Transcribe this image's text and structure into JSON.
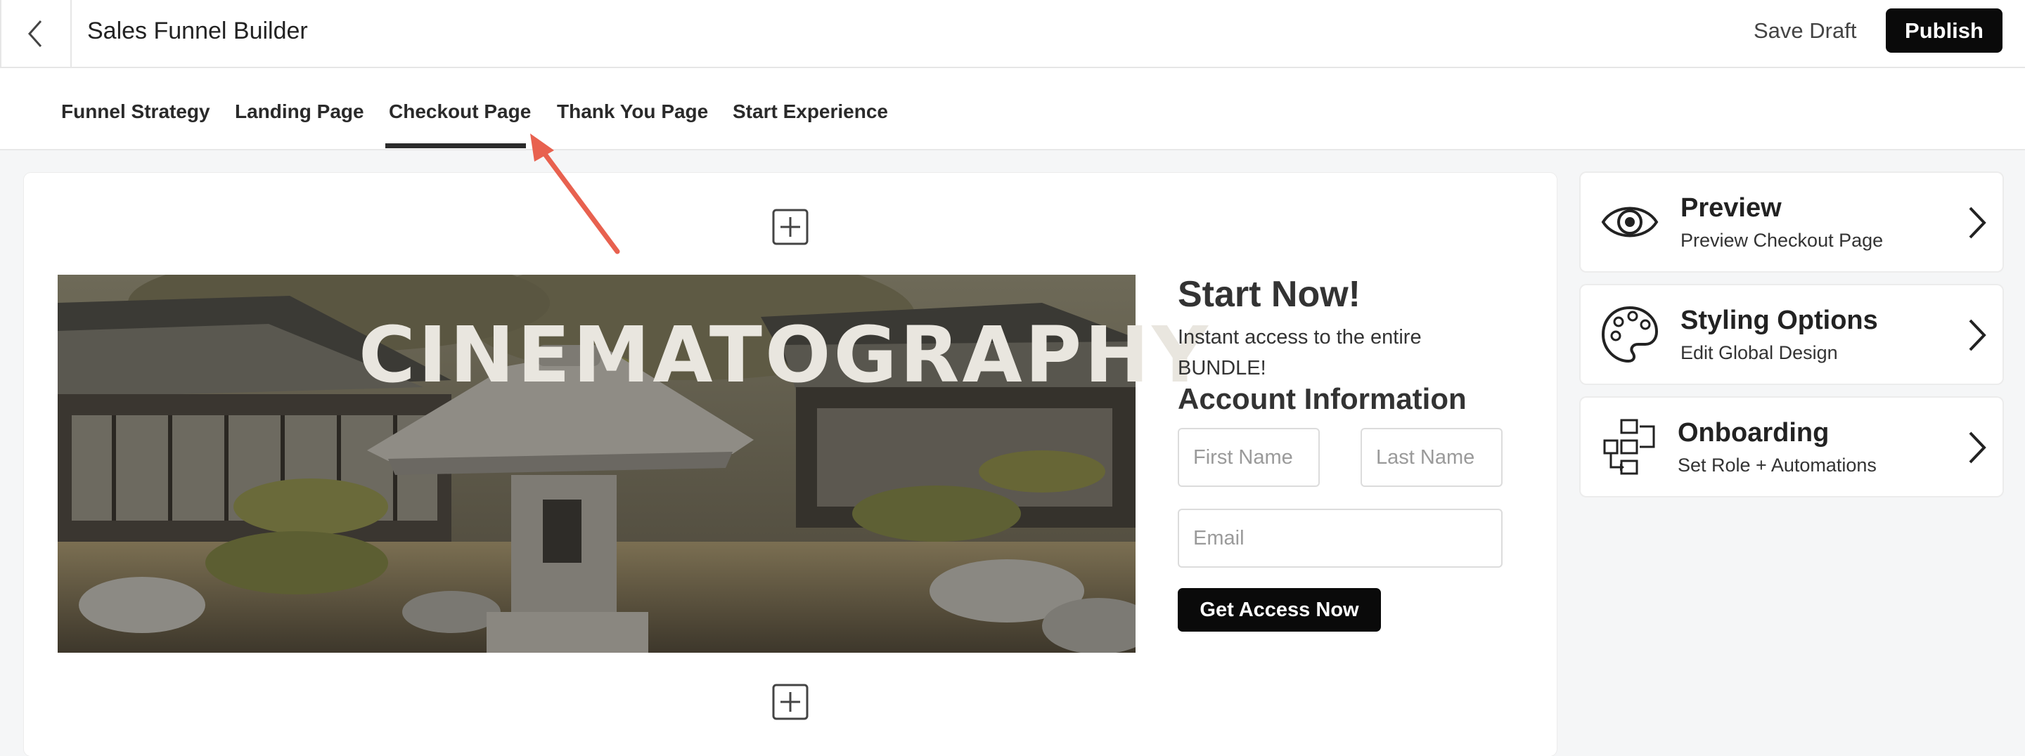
{
  "header": {
    "title": "Sales Funnel Builder",
    "save_draft_label": "Save Draft",
    "publish_label": "Publish",
    "back_icon": "chevron-left-icon"
  },
  "tabs": [
    {
      "label": "Funnel Strategy",
      "active": false
    },
    {
      "label": "Landing Page",
      "active": false
    },
    {
      "label": "Checkout Page",
      "active": true
    },
    {
      "label": "Thank You Page",
      "active": false
    },
    {
      "label": "Start Experience",
      "active": false
    }
  ],
  "editor": {
    "hero_overlay_text": "CINEMATOGRAPHY",
    "checkout": {
      "title": "Start Now!",
      "subtitle": "Instant access to the entire BUNDLE!",
      "section_title": "Account Information",
      "first_name_placeholder": "First Name",
      "last_name_placeholder": "Last Name",
      "email_placeholder": "Email",
      "cta_label": "Get Access Now"
    }
  },
  "side_panel": [
    {
      "title": "Preview",
      "subtitle": "Preview Checkout Page",
      "icon": "eye-icon"
    },
    {
      "title": "Styling Options",
      "subtitle": "Edit Global Design",
      "icon": "palette-icon"
    },
    {
      "title": "Onboarding",
      "subtitle": "Set Role + Automations",
      "icon": "flow-diagram-icon"
    }
  ],
  "colors": {
    "primary_button": "#0a0a0a",
    "annotation_arrow": "#e8614f",
    "active_tab_underline": "#2b2b2b"
  }
}
